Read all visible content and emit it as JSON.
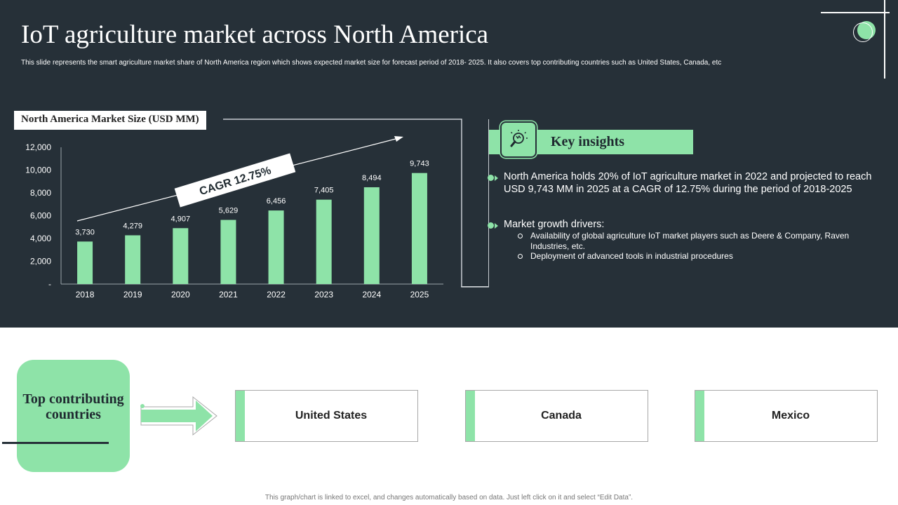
{
  "header": {
    "title": "IoT agriculture market across North America",
    "subtitle": "This slide represents the smart agriculture market share of North America region which shows expected market size for forecast period of 2018- 2025. It also covers top contributing countries such as United States, Canada, etc"
  },
  "chart_data": {
    "type": "bar",
    "title": "North America Market Size (USD MM)",
    "categories": [
      "2018",
      "2019",
      "2020",
      "2021",
      "2022",
      "2023",
      "2024",
      "2025"
    ],
    "values": [
      3730,
      4279,
      4907,
      5629,
      6456,
      7405,
      8494,
      9743
    ],
    "data_labels": [
      "3,730",
      "4,279",
      "4,907",
      "5,629",
      "6,456",
      "7,405",
      "8,494",
      "9,743"
    ],
    "y_ticks": [
      "-",
      "2,000",
      "4,000",
      "6,000",
      "8,000",
      "10,000",
      "12,000"
    ],
    "ylim": [
      0,
      12000
    ],
    "xlabel": "",
    "ylabel": "",
    "grid": false,
    "annotation": "CAGR 12.75%",
    "bar_color": "#8ee3a8"
  },
  "insights": {
    "title": "Key insights",
    "icon": "lightbulb-magnifier-icon",
    "point1": "North America holds 20% of IoT agriculture market in 2022 and projected to reach USD 9,743 MM in 2025 at a CAGR of 12.75% during the period of 2018-2025",
    "point2": "Market growth drivers:",
    "sub1": "Availability of global agriculture IoT market players such as Deere & Company, Raven Industries, etc.",
    "sub2": "Deployment of advanced tools in industrial procedures"
  },
  "countries": {
    "heading": "Top contributing countries",
    "list": [
      "United States",
      "Canada",
      "Mexico"
    ]
  },
  "colors": {
    "accent": "#8ee3a8",
    "dark_bg": "#263038"
  },
  "footnote": "This graph/chart is linked to excel, and changes automatically based on data. Just left click on it and select “Edit Data”."
}
